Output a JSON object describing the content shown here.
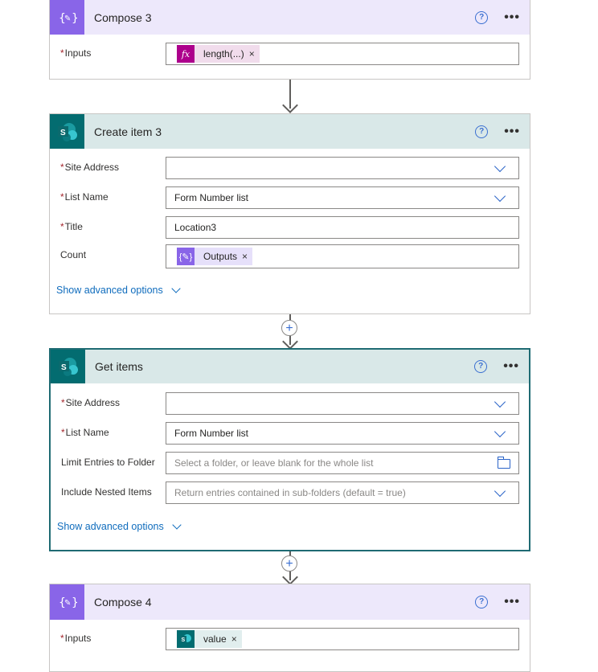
{
  "colors": {
    "compose": "#8965e8",
    "sharepoint": "#036c70",
    "expression": "#ad008c",
    "link": "#0f6cbd"
  },
  "required_mark": "*",
  "help_glyph": "?",
  "menu_glyph": "•••",
  "add_glyph": "+",
  "compose3": {
    "title": "Compose 3",
    "inputs_label": "Inputs",
    "token_icon": "fx",
    "token_label": "length(...)",
    "token_remove": "×"
  },
  "create_item3": {
    "title": "Create item 3",
    "site_address_label": "Site Address",
    "site_address_value": "",
    "list_name_label": "List Name",
    "list_name_value": "Form Number list",
    "title_label": "Title",
    "title_value": "Location3",
    "count_label": "Count",
    "count_token_label": "Outputs",
    "token_remove": "×",
    "advanced_link": "Show advanced options"
  },
  "get_items": {
    "title": "Get items",
    "site_address_label": "Site Address",
    "site_address_value": "",
    "list_name_label": "List Name",
    "list_name_value": "Form Number list",
    "limit_label": "Limit Entries to Folder",
    "limit_placeholder": "Select a folder, or leave blank for the whole list",
    "nested_label": "Include Nested Items",
    "nested_placeholder": "Return entries contained in sub-folders (default = true)",
    "advanced_link": "Show advanced options"
  },
  "compose4": {
    "title": "Compose 4",
    "inputs_label": "Inputs",
    "token_label": "value",
    "token_remove": "×"
  }
}
